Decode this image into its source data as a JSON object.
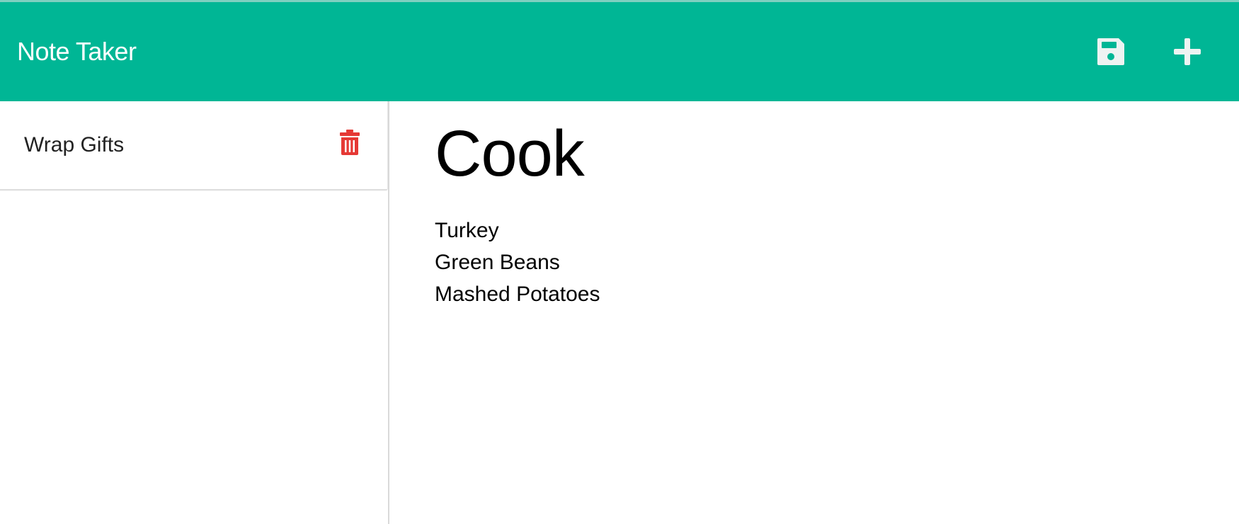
{
  "colors": {
    "navbar": "#00b695",
    "navbar_text": "#ffffff",
    "icon_light": "#eef3f2",
    "delete": "#e53935"
  },
  "header": {
    "title": "Note Taker",
    "save_icon": "floppy-disk-icon",
    "new_icon": "plus-icon"
  },
  "sidebar": {
    "items": [
      {
        "title": "Wrap Gifts",
        "delete_icon": "trash-icon"
      }
    ]
  },
  "note": {
    "title": "Cook",
    "text": "Turkey\nGreen Beans\nMashed Potatoes"
  }
}
